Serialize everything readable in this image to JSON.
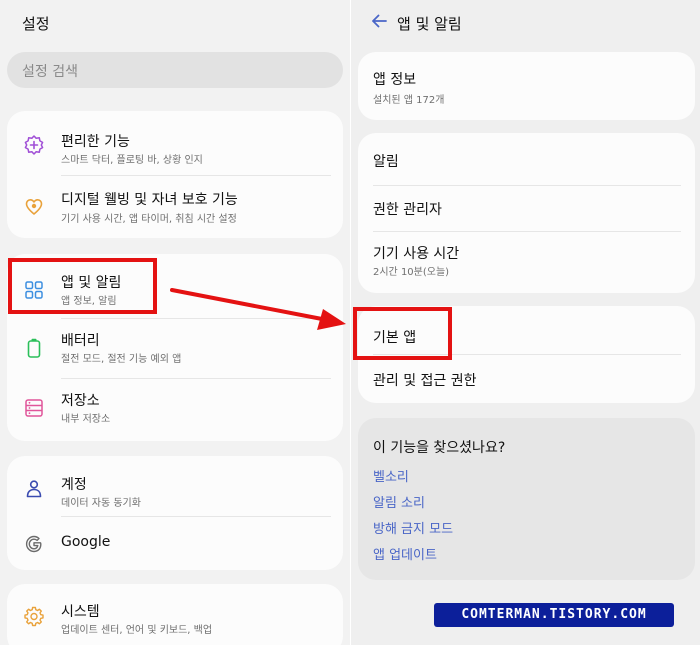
{
  "left": {
    "title": "설정",
    "search_placeholder": "설정 검색",
    "groups": [
      [
        {
          "icon": "accessibility-plus-icon",
          "title": "편리한 기능",
          "subtitle": "스마트 닥터, 플로팅 바, 상황 인지"
        },
        {
          "icon": "digital-wellbeing-heart-icon",
          "title": "디지털 웰빙 및 자녀 보호 기능",
          "subtitle": "기기 사용 시간, 앱 타이머, 취침 시간 설정"
        }
      ],
      [
        {
          "icon": "apps-grid-icon",
          "title": "앱 및 알림",
          "subtitle": "앱 정보, 알림"
        },
        {
          "icon": "battery-icon",
          "title": "배터리",
          "subtitle": "절전 모드, 절전 기능 예외 앱"
        },
        {
          "icon": "storage-icon",
          "title": "저장소",
          "subtitle": "내부 저장소"
        }
      ],
      [
        {
          "icon": "account-icon",
          "title": "계정",
          "subtitle": "데이터 자동 동기화"
        },
        {
          "icon": "google-icon",
          "title": "Google",
          "subtitle": ""
        }
      ],
      [
        {
          "icon": "system-gear-icon",
          "title": "시스템",
          "subtitle": "업데이트 센터, 언어 및 키보드, 백업"
        }
      ]
    ]
  },
  "right": {
    "title": "앱 및 알림",
    "app_info": {
      "title": "앱 정보",
      "subtitle": "설치된 앱 172개"
    },
    "group2": [
      {
        "title": "알림",
        "subtitle": ""
      },
      {
        "title": "권한 관리자",
        "subtitle": ""
      },
      {
        "title": "기기 사용 시간",
        "subtitle": "2시간 10분(오늘)"
      }
    ],
    "group3": [
      {
        "title": "기본 앱"
      },
      {
        "title": "관리 및 접근 권한"
      }
    ],
    "suggest": {
      "heading": "이 기능을 찾으셨나요?",
      "links": [
        "벨소리",
        "알림 소리",
        "방해 금지 모드",
        "앱 업데이트"
      ]
    }
  },
  "watermark": "COMTERMAN.TISTORY.COM",
  "colors": {
    "highlight": "#e41212",
    "link": "#4a66c7",
    "icon_purple": "#a04fd6",
    "icon_orange": "#e9a23b",
    "icon_blue": "#3d8fe0",
    "icon_green": "#2bbf5a",
    "icon_pink": "#e0559a",
    "icon_navy": "#3a4bb0",
    "watermark_bg": "#0c1f9a"
  }
}
